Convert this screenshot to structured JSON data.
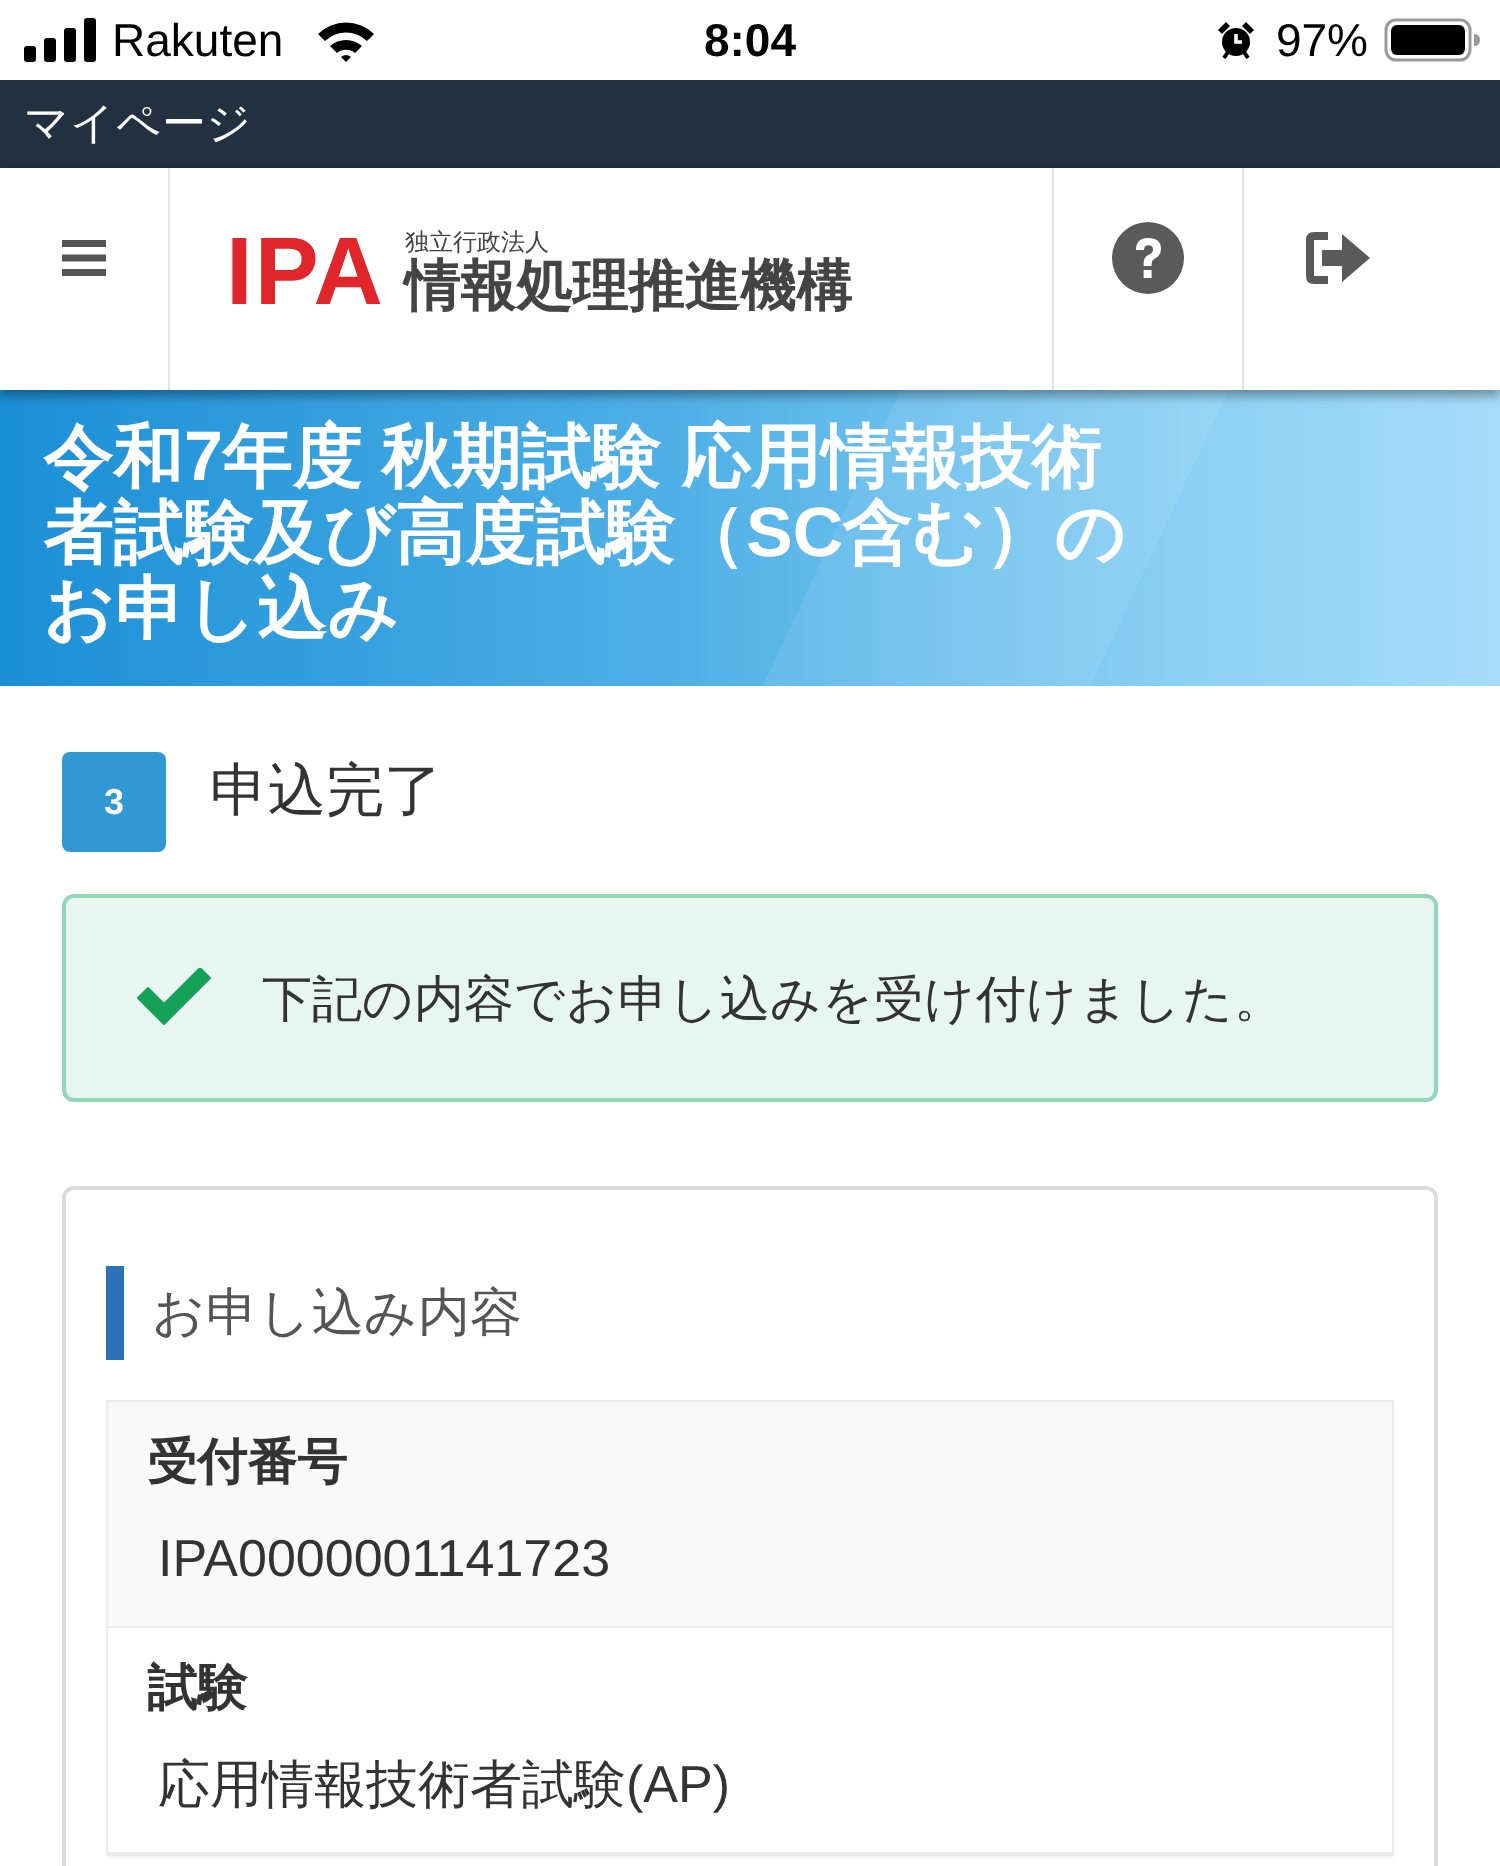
{
  "status_bar": {
    "carrier": "Rakuten",
    "time": "8:04",
    "battery": "97%"
  },
  "top_bar": {
    "title": "マイページ"
  },
  "header": {
    "logo_mark": "IPA",
    "logo_subtitle": "独立行政法人",
    "logo_name": "情報処理推進機構"
  },
  "banner": {
    "title_lines": [
      "令和7年度 秋期試験 応用情報技術",
      "者試験及び高度試験（SC含む）の",
      "お申し込み"
    ]
  },
  "step": {
    "number": "3",
    "title": "申込完了"
  },
  "alert": {
    "kind": "success",
    "message": "下記の内容でお申し込みを受け付けました。"
  },
  "details": {
    "heading": "お申し込み内容",
    "items": [
      {
        "label": "受付番号",
        "value": "IPA0000001141723"
      },
      {
        "label": "試験",
        "value": "応用情報技術者試験(AP)"
      }
    ]
  }
}
